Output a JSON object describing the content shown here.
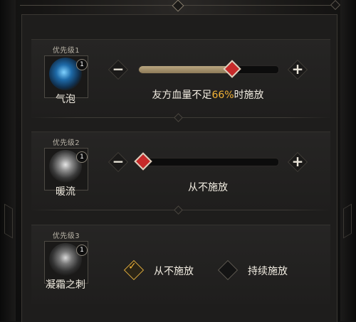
{
  "rows": [
    {
      "priority_label": "优先级1",
      "skill_name": "气泡",
      "skill_icon": "bubble-icon",
      "count": "1",
      "control": "slider",
      "minus_label": "−",
      "plus_label": "+",
      "slider_percent": 66,
      "caption_prefix": "友方血量不足",
      "caption_value": "66%",
      "caption_suffix": "时施放"
    },
    {
      "priority_label": "优先级2",
      "skill_name": "暖流",
      "skill_icon": "warm-flow-icon",
      "count": "1",
      "control": "slider",
      "minus_label": "−",
      "plus_label": "+",
      "slider_percent": 0,
      "caption": "从不施放"
    },
    {
      "priority_label": "优先级3",
      "skill_name": "凝霜之刺",
      "skill_icon": "frost-thorn-icon",
      "count": "1",
      "control": "choice",
      "options": [
        {
          "label": "从不施放",
          "selected": true
        },
        {
          "label": "持续施放",
          "selected": false
        }
      ]
    }
  ],
  "colors": {
    "accent": "#f2b236",
    "knob": "#c62a2a",
    "fill": "#b9a680",
    "panel": "#1e1d1c"
  }
}
